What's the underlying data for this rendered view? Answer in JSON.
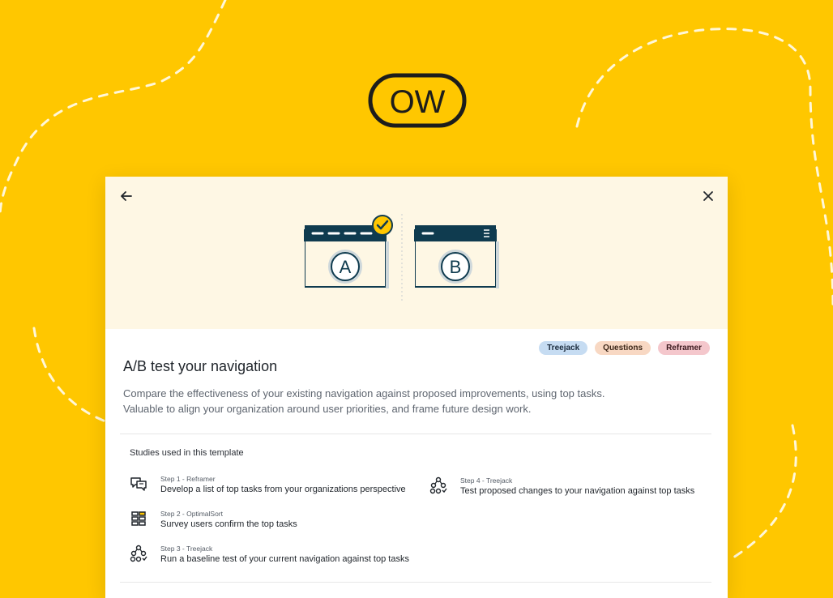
{
  "brand": {
    "logo_text": "OW",
    "logo_icon": "ow-logo"
  },
  "modal": {
    "back_icon": "arrow-left-icon",
    "close_icon": "close-icon",
    "illustration": {
      "variant_a_label": "A",
      "variant_b_label": "B"
    },
    "tags": [
      {
        "label": "Treejack",
        "color": "#C6DCF2"
      },
      {
        "label": "Questions",
        "color": "#F8D8C3"
      },
      {
        "label": "Reframer",
        "color": "#F4C7CC"
      }
    ],
    "title": "A/B test your navigation",
    "description_line1": "Compare the effectiveness of your existing navigation against proposed improvements, using top tasks.",
    "description_line2": "Valuable to align your organization around user priorities, and frame future design work.",
    "studies_heading": "Studies used in this template",
    "steps": [
      {
        "sub": "Step 1 - Reframer",
        "main": "Develop a list of top tasks from your organizations perspective",
        "icon": "reframer-icon"
      },
      {
        "sub": "Step 2 - OptimalSort",
        "main": "Survey users confirm the top tasks",
        "icon": "optimalsort-icon"
      },
      {
        "sub": "Step 3 - Treejack",
        "main": "Run a baseline test of your current navigation against top tasks",
        "icon": "treejack-icon"
      },
      {
        "sub": "Step 4 - Treejack",
        "main": "Test proposed changes to your navigation against top tasks",
        "icon": "treejack-icon"
      }
    ]
  },
  "colors": {
    "background": "#FFC700",
    "hero": "#FEF7E4",
    "illustration_navy": "#0F3B4F",
    "check_yellow": "#FFC700"
  }
}
